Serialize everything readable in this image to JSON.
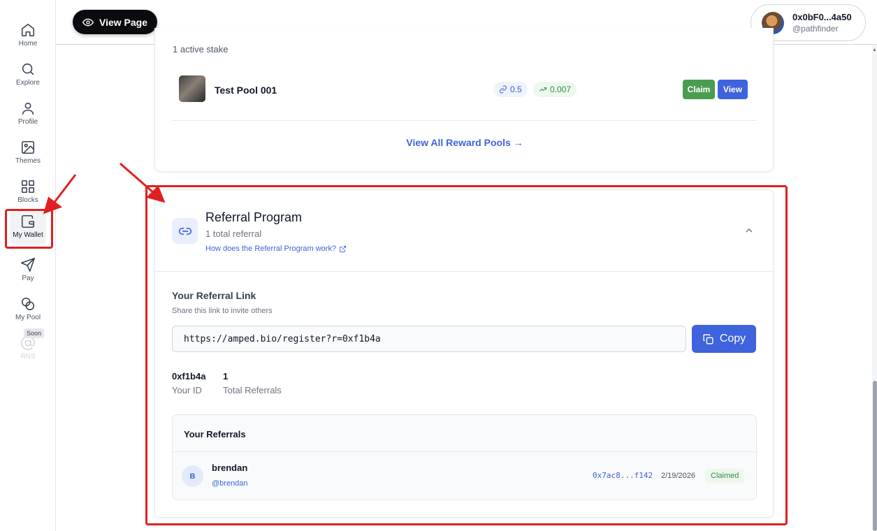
{
  "sidebar": {
    "items": [
      {
        "label": "Home",
        "icon": "home-icon"
      },
      {
        "label": "Explore",
        "icon": "search-icon"
      },
      {
        "label": "Profile",
        "icon": "user-icon"
      },
      {
        "label": "Themes",
        "icon": "image-icon"
      },
      {
        "label": "Blocks",
        "icon": "grid-icon"
      },
      {
        "label": "My Wallet",
        "icon": "wallet-icon",
        "active": true
      },
      {
        "label": "Pay",
        "icon": "send-icon"
      },
      {
        "label": "My Pool",
        "icon": "coins-icon"
      },
      {
        "label": "RNS",
        "icon": "at-sign-icon",
        "disabled": true,
        "badge": "Soon"
      }
    ]
  },
  "header": {
    "view_page_label": "View Page",
    "account": {
      "address": "0x0bF0...4a50",
      "handle": "@pathfinder"
    }
  },
  "stakes": {
    "count_text": "1 active stake",
    "pools": [
      {
        "name": "Test Pool 001",
        "stake": "0.5",
        "rewards": "0.007",
        "claim_label": "Claim",
        "view_label": "View"
      }
    ],
    "view_all_label": "View All Reward Pools →"
  },
  "referral": {
    "title": "Referral Program",
    "subtitle": "1 total referral",
    "help_link": "How does the Referral Program work?",
    "link_heading": "Your Referral Link",
    "link_subheading": "Share this link to invite others",
    "link_value": "https://amped.bio/register?r=0xf1b4a",
    "copy_label": "Copy",
    "stats": [
      {
        "value": "0xf1b4a",
        "label": "Your ID"
      },
      {
        "value": "1",
        "label": "Total Referrals"
      }
    ],
    "referrals_heading": "Your Referrals",
    "referrals": [
      {
        "initial": "B",
        "name": "brendan",
        "handle": "@brendan",
        "address": "0x7ac8...f142",
        "date": "2/19/2026",
        "status": "Claimed"
      }
    ]
  },
  "colors": {
    "accent": "#3e63dd",
    "claim_green": "#4a9d4f",
    "annotation_red": "#e02020"
  }
}
